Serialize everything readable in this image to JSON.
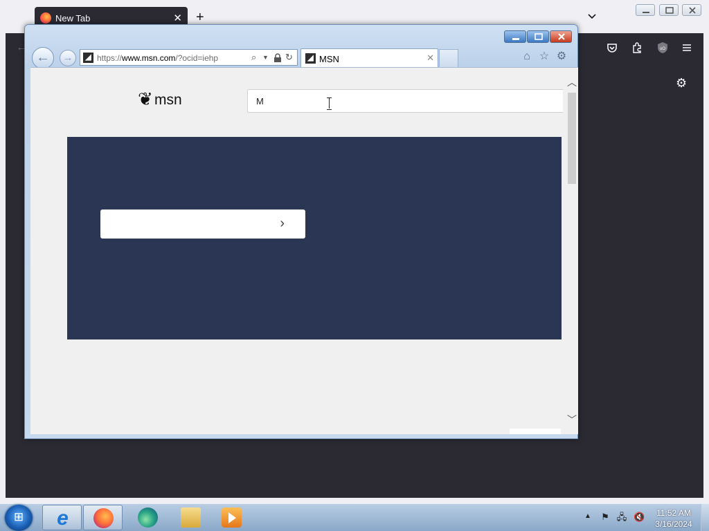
{
  "firefox": {
    "tab_title": "New Tab",
    "tab_close": "✕",
    "new_tab": "+",
    "min_icon": "minimize-icon",
    "toolbar_icons": [
      "back-icon",
      "pocket-icon",
      "extensions-icon",
      "ublock-icon",
      "menu-icon"
    ],
    "settings_icon": "gear-icon"
  },
  "ie": {
    "url_prefix": "https://",
    "url_host": "www.msn.com",
    "url_path": "/?ocid=iehp",
    "tab_title": "MSN",
    "tab_close": "✕",
    "favicon": "MSN"
  },
  "msn": {
    "logo_text": "msn",
    "search_value": "M",
    "banner_color": "#2b3655"
  },
  "taskbar": {
    "apps": [
      "Internet Explorer",
      "Firefox",
      "Edge",
      "Windows Explorer",
      "Windows Media Player"
    ],
    "time": "11:52 AM",
    "date": "3/16/2024"
  },
  "colors": {
    "firefox_dark": "#2b2a33",
    "msn_banner": "#2b3655"
  }
}
